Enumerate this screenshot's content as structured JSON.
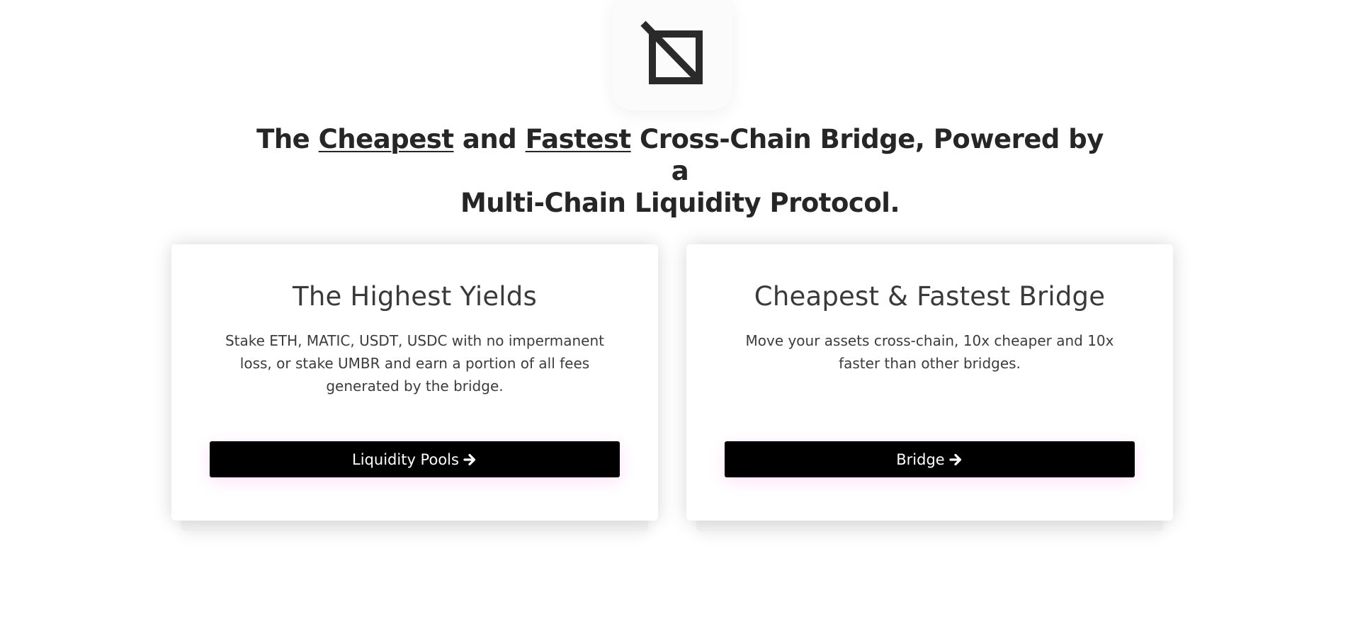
{
  "logo": {
    "icon": "umbria-logo-icon"
  },
  "headline": {
    "part1": "The ",
    "cheapest": "Cheapest",
    "part2": " and ",
    "fastest": "Fastest",
    "part3": " Cross-Chain Bridge, Powered by a",
    "line2": "Multi-Chain Liquidity Protocol."
  },
  "cards": [
    {
      "title": "The Highest Yields",
      "text": "Stake ETH, MATIC, USDT, USDC with no impermanent loss, or stake UMBR and earn a portion of all fees generated by the bridge.",
      "button_label": "Liquidity Pools",
      "button_icon": "arrow-right-icon"
    },
    {
      "title": "Cheapest & Fastest Bridge",
      "text": "Move your assets cross-chain, 10x cheaper and 10x faster than other bridges.",
      "button_label": "Bridge",
      "button_icon": "arrow-right-icon"
    }
  ],
  "colors": {
    "button_bg": "#000000",
    "button_text": "#ffffff",
    "headline": "#262626"
  }
}
